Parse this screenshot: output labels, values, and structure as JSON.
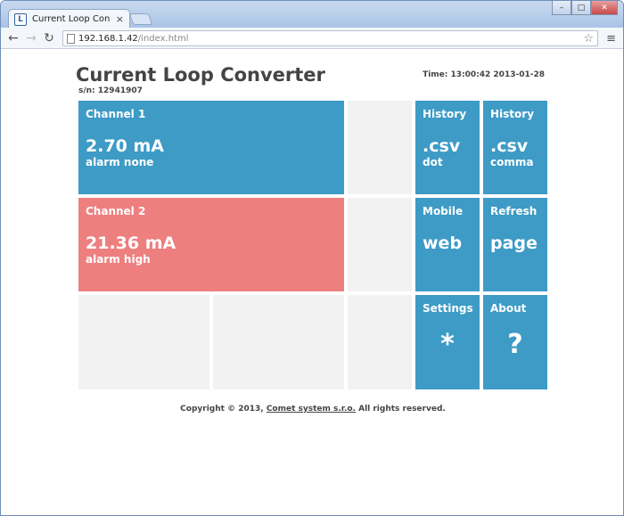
{
  "browser": {
    "tab_title": "Current Loop Converter",
    "tab_close": "×",
    "favicon_letter": "L",
    "url_host": "192.168.1.42",
    "url_path": "/index.html",
    "window_buttons": {
      "minimize": "–",
      "maximize": "□",
      "close": "✕"
    },
    "nav": {
      "back": "←",
      "forward": "→",
      "reload": "↻",
      "star": "☆",
      "menu": "≡"
    }
  },
  "page": {
    "title": "Current Loop Converter",
    "serial": "s/n: 12941907",
    "time": "Time: 13:00:42 2013-01-28"
  },
  "channels": [
    {
      "label": "Channel 1",
      "value": "2.70 mA",
      "alarm": "alarm none",
      "color": "#3d9bc6"
    },
    {
      "label": "Channel 2",
      "value": "21.36 mA",
      "alarm": "alarm high",
      "color": "#ee7f7f"
    }
  ],
  "tiles": {
    "history_dot": {
      "label": "History",
      "big": ".csv",
      "sub": "dot"
    },
    "history_comma": {
      "label": "History",
      "big": ".csv",
      "sub": "comma"
    },
    "mobile": {
      "label": "Mobile",
      "big": "web"
    },
    "refresh": {
      "label": "Refresh",
      "big": "page"
    },
    "settings": {
      "label": "Settings",
      "symbol": "*"
    },
    "about": {
      "label": "About",
      "symbol": "?"
    }
  },
  "footer": {
    "prefix": "Copyright © 2013, ",
    "link": "Comet system s.r.o.",
    "suffix": " All rights reserved."
  },
  "colors": {
    "tile_blue": "#3d9bc6",
    "tile_red": "#ee7f7f",
    "tile_empty": "#f2f2f2"
  }
}
